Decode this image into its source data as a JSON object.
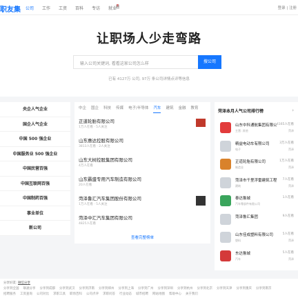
{
  "header": {
    "logo": "职友集",
    "nav": [
      {
        "label": "公司",
        "active": true
      },
      {
        "label": "工作"
      },
      {
        "label": "工资"
      },
      {
        "label": "百科"
      },
      {
        "label": "专访"
      },
      {
        "label": "就业"
      }
    ],
    "login": "登录 | 注册"
  },
  "hero": {
    "title": "让职场人少走弯路",
    "search_placeholder": "输入公司关键词, 看看这家公司怎么样",
    "search_button": "搜公司",
    "stats": "已有 4127万 公司, 97万 条公司详情点评等信息"
  },
  "categories": [
    "央企人气企业",
    "国企人气企业",
    "中国 500 强企业",
    "中国服务业 500 强企业",
    "中国民营百强",
    "中国互联网百强",
    "中国制药百强",
    "事业单位",
    "新公司"
  ],
  "tabs": [
    {
      "label": "中企"
    },
    {
      "label": "国企"
    },
    {
      "label": "科技"
    },
    {
      "label": "传媒"
    },
    {
      "label": "电子/半导体"
    },
    {
      "label": "汽车",
      "active": true
    },
    {
      "label": "建筑"
    },
    {
      "label": "金融"
    },
    {
      "label": "教育"
    }
  ],
  "companies": [
    {
      "name": "正道轮胎有限公司",
      "sub": "1万人在看 · 5人关注",
      "logo": "red"
    },
    {
      "name": "山东惠达控股有限公司",
      "sub": "3813人在看 · 2人关注"
    },
    {
      "name": "山东大树控股集团有限公司",
      "sub": "4万人在看"
    },
    {
      "name": "山东霸盛专用汽车制造有限公司",
      "sub": "20人在看"
    },
    {
      "name": "菏泽鲁汇汽车集团股份有限公司",
      "sub": "1万人在看 · 5人关注",
      "logo": "dark"
    },
    {
      "name": "菏泽中汇汽车集团有限公司",
      "sub": "4825人在看"
    }
  ],
  "more_link": "查看完整榜单",
  "ranking": {
    "title": "菏泽本月人气公司排行榜",
    "items": [
      {
        "name": "山东中科通航集团有限公司",
        "count": "4165人在看",
        "sub": "主营: 其他",
        "sub2": "菏泽",
        "logo": "#e23b3b"
      },
      {
        "name": "精益电动车有限公司",
        "count": "3万人在看",
        "sub": "电子",
        "sub2": "菏泽",
        "logo": "#cfd4da"
      },
      {
        "name": "正道轮胎有限公司",
        "count": "1万人在看",
        "sub": "制造业",
        "sub2": "菏泽",
        "logo": "#d9822b"
      },
      {
        "name": "菏泽市千里浮雷建筑工程有限公司",
        "count": "7人在看",
        "sub": "建筑",
        "sub2": "菏泽",
        "logo": "#cfd4da"
      },
      {
        "name": "泰达鲁城",
        "count": "1人在看",
        "sub": "汽车零部件有限公司",
        "sub2": "",
        "logo": "#3aa55c"
      },
      {
        "name": "菏泽鲁汇集团",
        "count": "9人在看",
        "sub": "",
        "sub2": "",
        "logo": "#cfd4da"
      },
      {
        "name": "山东佳成塑料有限公司",
        "count": "5人在看",
        "sub": "塑料",
        "sub2": "菏泽",
        "logo": "#cfd4da"
      },
      {
        "name": "东达鲁城",
        "count": "5人在看",
        "sub": "汽车",
        "sub2": "菏泽",
        "logo": "#d43a3a"
      }
    ]
  },
  "footer": {
    "label": "分享好友:",
    "label_link": "微信分享",
    "row1": [
      "分享到全国",
      "联通分享",
      "分享到成都",
      "分享到武汉",
      "分享到济南",
      "分享到郑州",
      "分享到上海",
      "分享到广州",
      "分享到深圳",
      "分享到杭州",
      "分享到北京",
      "分享到天津",
      "分享到重庆",
      "分享到南京"
    ],
    "row2": [
      "招聘服务",
      "工资查询",
      "公司对比",
      "求职工具",
      "职场百科",
      "公司点评",
      "求职问答",
      "行业动态",
      "城市招聘",
      "网站地图",
      "帮助中心",
      "关于我们"
    ]
  }
}
